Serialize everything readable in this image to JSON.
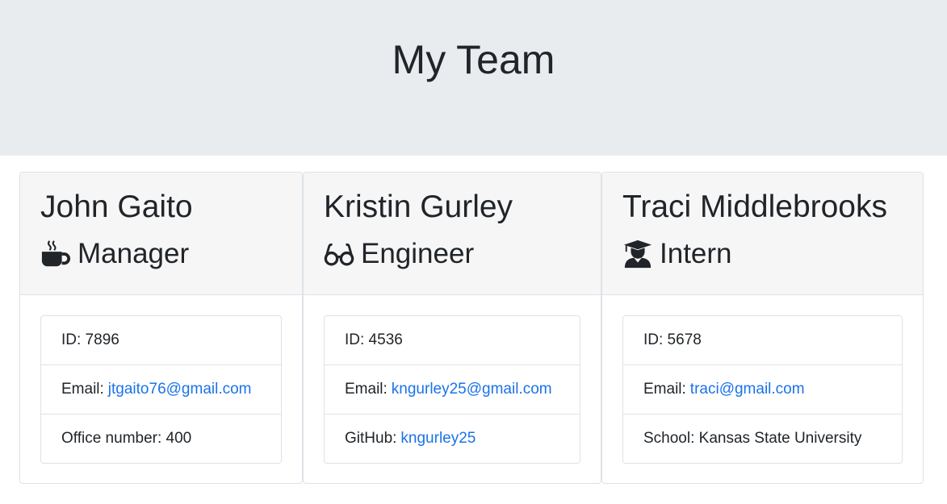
{
  "header": {
    "title": "My Team"
  },
  "cards": [
    {
      "name": "John Gaito",
      "role": "Manager",
      "role_icon": "coffee-icon",
      "id_text": "ID: 7896",
      "email_label": "Email:",
      "email": "jtgaito76@gmail.com",
      "extra_text": "Office number: 400"
    },
    {
      "name": "Kristin Gurley",
      "role": "Engineer",
      "role_icon": "glasses-icon",
      "id_text": "ID: 4536",
      "email_label": "Email:",
      "email": "kngurley25@gmail.com",
      "extra_label": "GitHub:",
      "extra_link": "kngurley25"
    },
    {
      "name": "Traci Middlebrooks",
      "role": "Intern",
      "role_icon": "graduate-icon",
      "id_text": "ID: 5678",
      "email_label": "Email:",
      "email": "traci@gmail.com",
      "extra_text": "School: Kansas State University"
    }
  ],
  "colors": {
    "link": "#1a73e8",
    "jumbotron": "#e9ecef",
    "card_header": "#f6f6f6"
  }
}
